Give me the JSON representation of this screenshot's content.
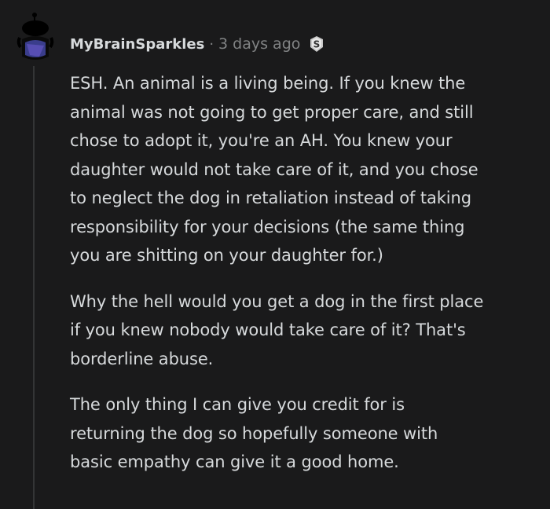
{
  "comment": {
    "username": "MyBrainSparkles",
    "separator": "·",
    "timestamp": "3 days ago",
    "award_icon": "silver-award-icon",
    "paragraphs": [
      {
        "lines": [
          "ESH. An animal is a living being. If you knew the",
          "animal was not going to get proper care, and still",
          "chose to adopt it, you're an AH. You knew your",
          "daughter would not take care of it, and you chose",
          "to neglect the dog in retaliation instead of taking",
          "responsibility for your decisions (the same thing",
          "you are shitting on your daughter for.)"
        ]
      },
      {
        "lines": [
          "Why the hell would you get a dog in the first place",
          "if you knew nobody would take care of it? That's",
          "borderline abuse."
        ]
      },
      {
        "lines": [
          "The only thing I can give you credit for is",
          "returning the dog so hopefully someone with",
          "basic empathy can give it a good home."
        ]
      }
    ]
  },
  "colors": {
    "background": "#1a1a1b",
    "text": "#d7dadc",
    "meta": "#818384",
    "thread_line": "#343536"
  }
}
